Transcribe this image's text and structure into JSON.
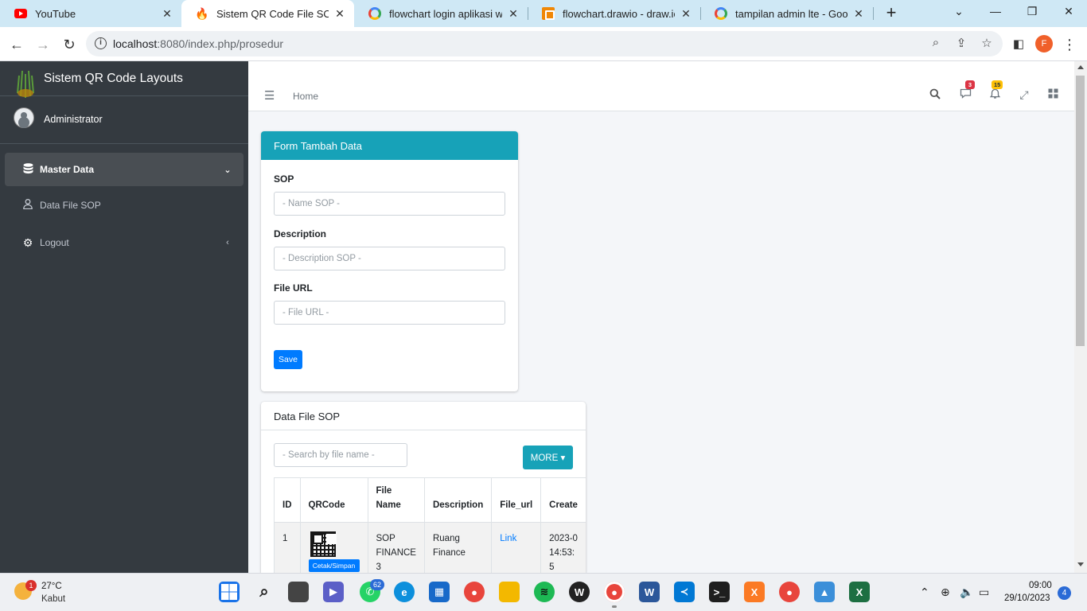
{
  "browser": {
    "tabs": [
      {
        "title": "YouTube",
        "icon": "youtube-icon"
      },
      {
        "title": "Sistem QR Code File SOP",
        "icon": "flame-icon",
        "active": true
      },
      {
        "title": "flowchart login aplikasi web",
        "icon": "google-icon"
      },
      {
        "title": "flowchart.drawio - draw.io",
        "icon": "drawio-icon"
      },
      {
        "title": "tampilan admin lte - Google",
        "icon": "google-icon"
      }
    ],
    "url_host": "localhost",
    "url_rest": ":8080/index.php/prosedur",
    "profile_initial": "F"
  },
  "sidebar": {
    "brand": "Sistem QR Code Layouts",
    "user": "Administrator",
    "items": [
      {
        "label": "Master Data",
        "icon": "database-icon",
        "active": true
      },
      {
        "label": "Data File SOP",
        "icon": "user-icon"
      },
      {
        "label": "Logout",
        "icon": "cogs-icon"
      }
    ]
  },
  "header": {
    "home": "Home",
    "messages_badge": "3",
    "notifications_badge": "15"
  },
  "form": {
    "title": "Form Tambah Data",
    "sop_label": "SOP",
    "sop_placeholder": "- Name SOP -",
    "desc_label": "Description",
    "desc_placeholder": "- Description SOP -",
    "url_label": "File URL",
    "url_placeholder": "- File URL -",
    "save_label": "Save"
  },
  "table_card": {
    "title": "Data File SOP",
    "search_placeholder": "- Search by file name -",
    "more_label": "MORE",
    "columns": [
      "ID",
      "QRCode",
      "File Name",
      "Description",
      "File_url",
      "Create"
    ],
    "rows": [
      {
        "id": "1",
        "qr_button": "Cetak/Simpan",
        "file_name": "SOP FINANCE 3",
        "description": "Ruang Finance",
        "file_url": "Link",
        "created": "2023-0 14:53:5"
      }
    ]
  },
  "taskbar": {
    "weather_badge": "1",
    "temperature": "27°C",
    "weather": "Kabut",
    "whatsapp_badge": "62",
    "time": "09:00",
    "date": "29/10/2023",
    "notifications": "4"
  },
  "colors": {
    "sidebar": "#343a40",
    "teal": "#17a2b8",
    "primary": "#007bff",
    "tabbar": "#cfe8f5"
  }
}
